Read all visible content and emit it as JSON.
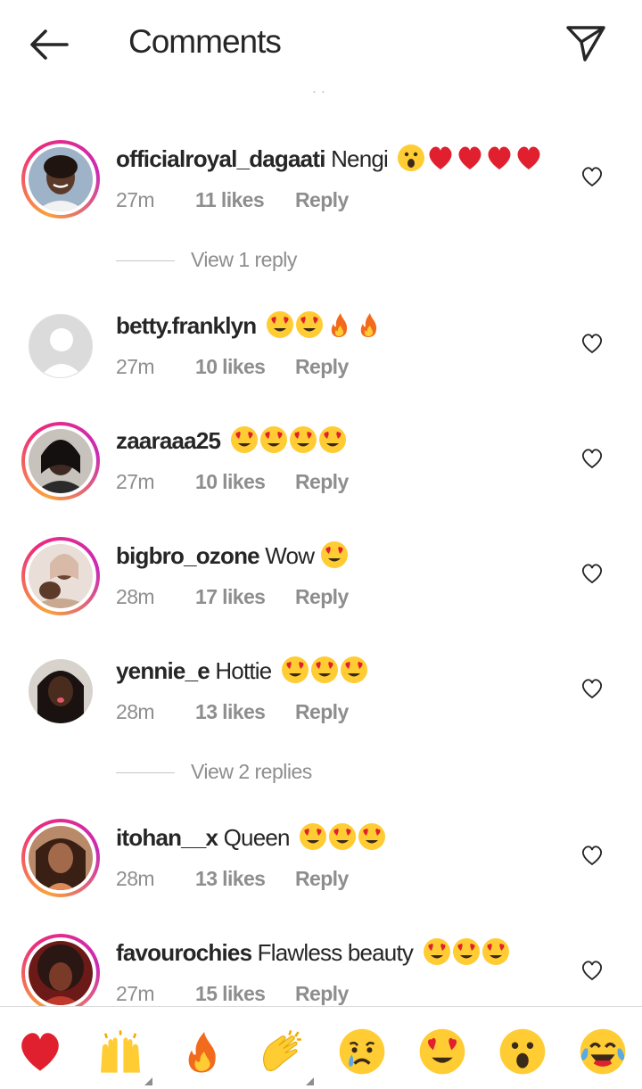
{
  "header": {
    "title": "Comments"
  },
  "list": {
    "cut_text": "∙ ∙"
  },
  "comments": [
    {
      "username": "officialroyal_dagaati",
      "text": "Nengi",
      "emojis": [
        "surprised-face",
        "red-heart",
        "red-heart",
        "red-heart",
        "red-heart"
      ],
      "time": "27m",
      "likes": "11 likes",
      "reply": "Reply",
      "story_ring": true
    },
    {
      "username": "betty.franklyn",
      "text": "",
      "emojis": [
        "heart-eyes",
        "heart-eyes",
        "fire",
        "fire"
      ],
      "time": "27m",
      "likes": "10 likes",
      "reply": "Reply",
      "story_ring": false
    },
    {
      "username": "zaaraaa25",
      "text": "",
      "emojis": [
        "heart-eyes",
        "heart-eyes",
        "heart-eyes",
        "heart-eyes"
      ],
      "time": "27m",
      "likes": "10 likes",
      "reply": "Reply",
      "story_ring": true
    },
    {
      "username": "bigbro_ozone",
      "text": "Wow",
      "emojis": [
        "heart-eyes"
      ],
      "time": "28m",
      "likes": "17 likes",
      "reply": "Reply",
      "story_ring": true
    },
    {
      "username": "yennie_e",
      "text": "Hottie",
      "emojis": [
        "heart-eyes",
        "heart-eyes",
        "heart-eyes"
      ],
      "time": "28m",
      "likes": "13 likes",
      "reply": "Reply",
      "story_ring": false
    },
    {
      "username": "itohan__x",
      "text": "Queen",
      "emojis": [
        "heart-eyes",
        "heart-eyes",
        "heart-eyes"
      ],
      "time": "28m",
      "likes": "13 likes",
      "reply": "Reply",
      "story_ring": true
    },
    {
      "username": "favourochies",
      "text": "Flawless beauty",
      "emojis": [
        "heart-eyes",
        "heart-eyes",
        "heart-eyes"
      ],
      "time": "27m",
      "likes": "15 likes",
      "reply": "Reply",
      "story_ring": true
    }
  ],
  "view_replies": [
    {
      "label": "View 1 reply"
    },
    {
      "label": "View 2 replies"
    }
  ],
  "quick_reactions": [
    {
      "icon": "red-heart-icon"
    },
    {
      "icon": "raising-hands-icon"
    },
    {
      "icon": "fire-icon"
    },
    {
      "icon": "clapping-hands-icon"
    },
    {
      "icon": "crying-face-icon"
    },
    {
      "icon": "heart-eyes-icon"
    },
    {
      "icon": "surprised-face-icon"
    },
    {
      "icon": "tears-of-joy-icon"
    }
  ],
  "colors": {
    "text": "#262626",
    "secondary": "#8e8e8e",
    "divider": "#dbdbdb",
    "story_ring_start": "#f9a23b",
    "story_ring_end": "#c92bb7"
  }
}
